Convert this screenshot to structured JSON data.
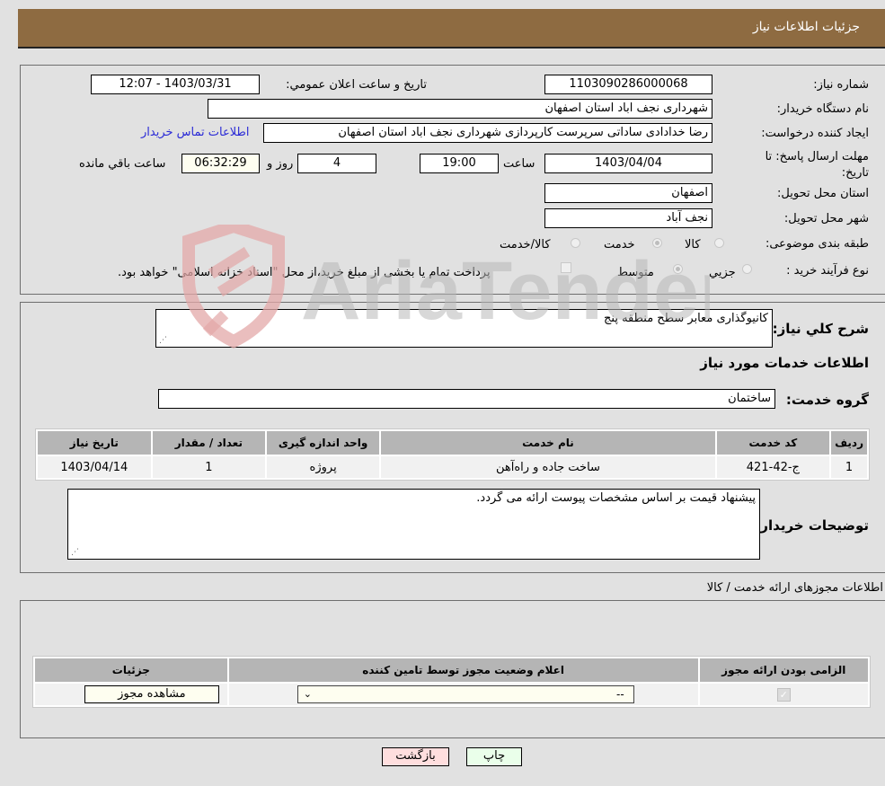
{
  "header": {
    "title": "جزئیات اطلاعات نیاز"
  },
  "info": {
    "need_number_label": "شماره نیاز:",
    "need_number": "1103090286000068",
    "announce_label": "تاریخ و ساعت اعلان عمومي:",
    "announce_value": "1403/03/31 - 12:07",
    "buyer_org_label": "نام دستگاه خریدار:",
    "buyer_org": "شهرداری نجف اباد استان اصفهان",
    "creator_label": "ایجاد کننده درخواست:",
    "creator": "رضا خدادادی ساداتی سرپرست  کارپردازی شهرداری نجف اباد استان اصفهان",
    "contact_link": "اطلاعات تماس خریدار",
    "deadline_label": "مهلت ارسال پاسخ: تا تاریخ:",
    "deadline_date": "1403/04/04",
    "time_label": "ساعت",
    "deadline_time": "19:00",
    "days": "4",
    "days_label": "روز و",
    "remaining": "06:32:29",
    "remaining_label": "ساعت باقي مانده",
    "province_label": "استان محل تحویل:",
    "province": "اصفهان",
    "city_label": "شهر محل تحویل:",
    "city": "نجف آباد",
    "category_label": "طبقه بندی موضوعی:",
    "category_options": [
      {
        "label": "کالا",
        "selected": false
      },
      {
        "label": "خدمت",
        "selected": true
      },
      {
        "label": "کالا/خدمت",
        "selected": false
      }
    ],
    "process_label": "نوع فرآیند خرید :",
    "process_options": [
      {
        "label": "جزيي",
        "selected": false
      },
      {
        "label": "متوسط",
        "selected": true
      }
    ],
    "treasury_note": "پرداخت تمام یا بخشی از مبلغ خرید،از محل \"اسناد خزانه اسلامی\" خواهد بود.",
    "treasury_checked": false
  },
  "details": {
    "summary_label": "شرح کلي نیاز:",
    "summary": "کانیوگذاری معابر سطح منطقه پنج",
    "services_heading": "اطلاعات خدمات مورد نیاز",
    "service_group_label": "گروه خدمت:",
    "service_group": "ساختمان",
    "table": {
      "headers": [
        "ردیف",
        "کد خدمت",
        "نام خدمت",
        "واحد اندازه گیری",
        "تعداد / مقدار",
        "تاریخ نیاز"
      ],
      "rows": [
        [
          "1",
          "ج-42-421",
          "ساخت جاده و راه‌آهن",
          "پروژه",
          "1",
          "1403/04/14"
        ]
      ]
    },
    "buyer_notes_label": "توضیحات خریدار:",
    "buyer_notes": "پیشنهاد قیمت بر اساس مشخصات پیوست ارائه می گردد."
  },
  "permits": {
    "heading": "اطلاعات مجوزهای ارائه خدمت / کالا",
    "headers": [
      "الزامی بودن ارائه مجوز",
      "اعلام وضعیت مجوز توسط تامین کننده",
      "جزئیات"
    ],
    "row": {
      "required": true,
      "status": "--",
      "details_button": "مشاهده مجوز"
    }
  },
  "actions": {
    "print": "چاپ",
    "back": "بازگشت"
  },
  "watermark": "AriaTender.neT"
}
